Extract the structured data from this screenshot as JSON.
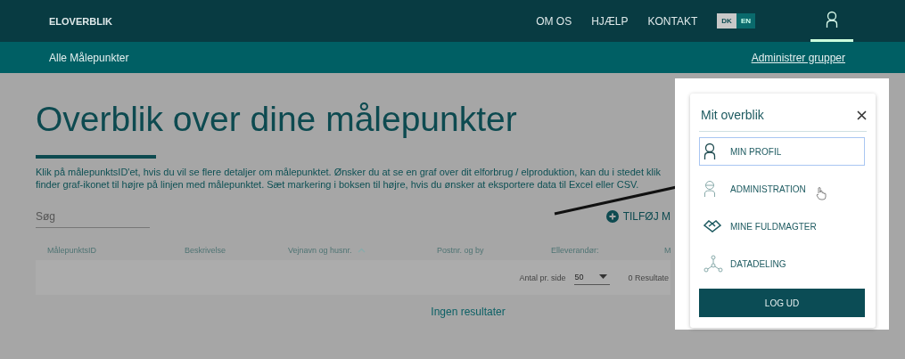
{
  "topbar": {
    "brand": "ELOVERBLIK",
    "nav": [
      "OM OS",
      "HJÆLP",
      "KONTAKT"
    ],
    "languages": [
      {
        "label": "DK",
        "selected": true
      },
      {
        "label": "EN",
        "selected": false
      }
    ],
    "user_menu_open": true
  },
  "subbar": {
    "title": "Alle Målepunkter",
    "link": "Administrer grupper"
  },
  "page": {
    "heading": "Overblik over dine målepunkter",
    "intro": [
      "Klik på målepunktsID'et, hvis du vil se flere detaljer om målepunktet. Ønsker du at se en graf over dit elforbrug / elproduktion, kan du i stedet klik",
      "finder graf-ikonet til højre på linjen med målepunktet. Sæt markering i boksen til højre, hvis du ønsker at eksportere data til Excel eller CSV."
    ],
    "search": {
      "placeholder": "Søg"
    },
    "add_button": "TILFØJ M",
    "table": {
      "columns": [
        {
          "label": "MålepunktsID",
          "sorted": false
        },
        {
          "label": "Beskrivelse",
          "sorted": false
        },
        {
          "label": "Vejnavn og husnr.",
          "sorted": true
        },
        {
          "label": "Postnr. og by",
          "sorted": false
        },
        {
          "label": "Elleverandør:",
          "sorted": false
        },
        {
          "label": "M",
          "sorted": false
        }
      ],
      "per_page_label": "Antal pr. side",
      "per_page": "50",
      "results": "0 Resultate",
      "empty": "Ingen resultater"
    }
  },
  "menu": {
    "title": "Mit overblik",
    "items": [
      {
        "kind": "profile",
        "label": "MIN PROFIL",
        "selected": true
      },
      {
        "kind": "admin",
        "label": "ADMINISTRATION",
        "selected": false
      },
      {
        "kind": "handshake",
        "label": "MINE FULDMAGTER",
        "selected": false
      },
      {
        "kind": "share",
        "label": "DATADELING",
        "selected": false
      }
    ],
    "logout": "LOG UD"
  }
}
